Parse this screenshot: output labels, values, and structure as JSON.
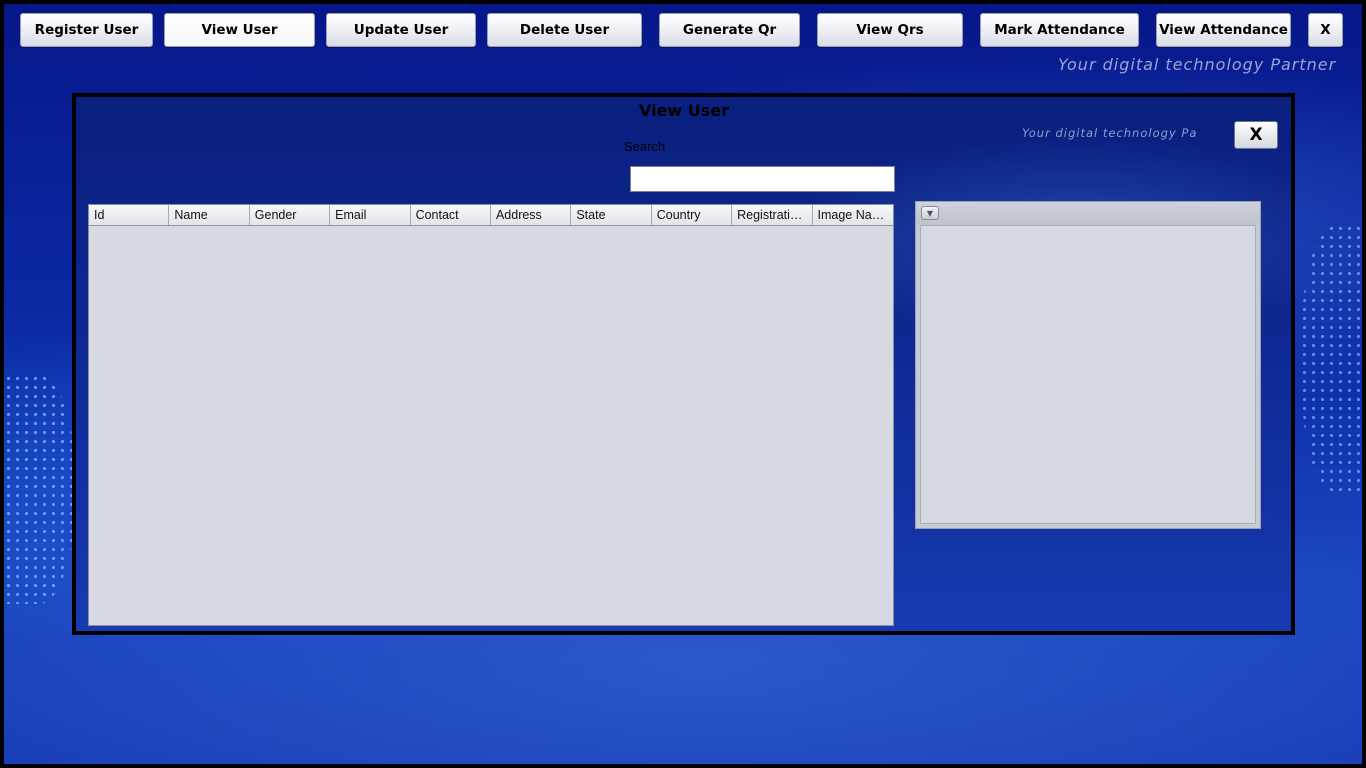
{
  "nav": {
    "register": "Register User",
    "view": "View User",
    "update": "Update User",
    "delete": "Delete User",
    "generate_qr": "Generate Qr",
    "view_qrs": "View Qrs",
    "mark_attendance": "Mark Attendance",
    "view_attendance": "View Attendance",
    "close": "X"
  },
  "tagline": "Your digital technology Partner",
  "panel": {
    "title": "View User",
    "search_label": "Search",
    "search_value": "",
    "close": "X",
    "watermark": "Your digital technology Pa"
  },
  "table": {
    "columns": [
      "Id",
      "Name",
      "Gender",
      "Email",
      "Contact",
      "Address",
      "State",
      "Country",
      "Registration Date",
      "Image Name"
    ],
    "rows": []
  },
  "image_panel": {
    "dropdown_icon": "chevron-down-icon"
  },
  "colors": {
    "background": "#0c2ba6",
    "panel_bg": "#0d2790",
    "table_bg": "#d6d9e1"
  }
}
